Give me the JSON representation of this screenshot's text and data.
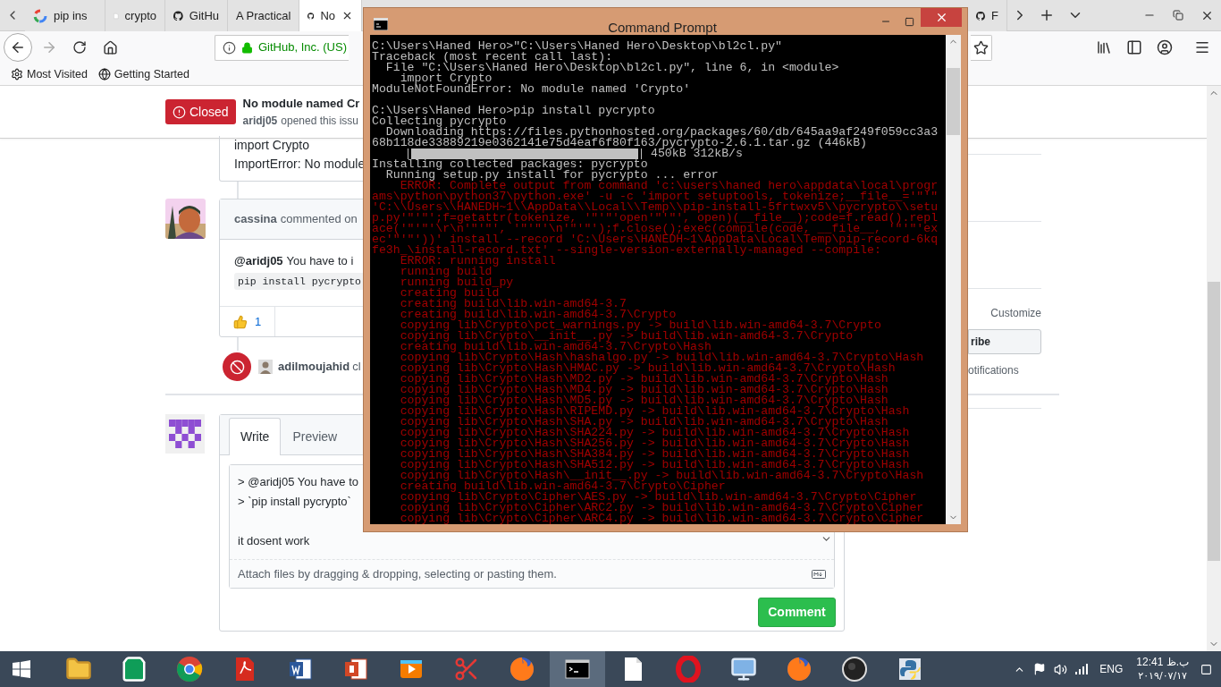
{
  "browser": {
    "tabs": [
      {
        "title": "pip ins",
        "kind": "google",
        "selected": false
      },
      {
        "title": "crypto",
        "kind": "page",
        "selected": false
      },
      {
        "title": "GitHu",
        "kind": "github",
        "selected": false
      },
      {
        "title": "A Practical",
        "kind": "none",
        "selected": false
      },
      {
        "title": "No",
        "kind": "github",
        "selected": true
      },
      {
        "title": "F",
        "kind": "github",
        "selected": false
      }
    ],
    "identity": "GitHub, Inc. (US)",
    "bookmarks": [
      {
        "label": "Most Visited",
        "kind": "gear"
      },
      {
        "label": "Getting Started",
        "kind": "globe"
      }
    ]
  },
  "issue": {
    "status": "Closed",
    "title": "No module named Cr",
    "author": "aridj05",
    "byline": "opened this issu",
    "body_lines": [
      "import Crypto",
      "ImportError: No module"
    ],
    "comment": {
      "author": "cassina",
      "action": "commented on",
      "mention": "@aridj05",
      "text": "You have to i",
      "code": "pip install pycrypto",
      "reaction_count": "1"
    },
    "event": {
      "actor": "adilmoujahid",
      "text": "cl"
    },
    "new_comment": {
      "tabs": [
        {
          "label": "Write",
          "selected": true
        },
        {
          "label": "Preview",
          "selected": false
        }
      ],
      "value": "> @aridj05 You have to\n> `pip install pycrypto`\n\nit dosent work",
      "attach": "Attach files by dragging & dropping, selecting or pasting them.",
      "button": "Comment"
    },
    "sidebar": {
      "customize": "Customize",
      "button": "ribe",
      "note": "otifications"
    }
  },
  "console": {
    "title": "Command Prompt",
    "lines": [
      {
        "kind": "normal",
        "text": "C:\\Users\\Haned Hero>\"C:\\Users\\Haned Hero\\Desktop\\bl2cl.py\""
      },
      {
        "kind": "normal",
        "text": "Traceback (most recent call last):"
      },
      {
        "kind": "normal",
        "text": "  File \"C:\\Users\\Haned Hero\\Desktop\\bl2cl.py\", line 6, in <module>"
      },
      {
        "kind": "normal",
        "text": "    import Crypto"
      },
      {
        "kind": "normal",
        "text": "ModuleNotFoundError: No module named 'Crypto'"
      },
      {
        "kind": "blank"
      },
      {
        "kind": "normal",
        "text": "C:\\Users\\Haned Hero>pip install pycrypto"
      },
      {
        "kind": "normal",
        "text": "Collecting pycrypto"
      },
      {
        "kind": "normal",
        "text": "  Downloading https://files.pythonhosted.org/packages/60/db/645aa9af249f059cc3a3"
      },
      {
        "kind": "normal",
        "text": "68b118de33889219e0362141e75d4eaf6f80f163/pycrypto-2.6.1.tar.gz (446kB)"
      },
      {
        "kind": "progress",
        "level": 1,
        "reading": "450kB 312kB/s"
      },
      {
        "kind": "normal",
        "text": "Installing collected packages: pycrypto"
      },
      {
        "kind": "normal",
        "text": "  Running setup.py install for pycrypto ... error"
      },
      {
        "kind": "error",
        "text": "    ERROR: Complete output from command 'c:\\users\\haned hero\\appdata\\local\\progr"
      },
      {
        "kind": "error",
        "text": "ams\\python\\python37\\python.exe' -u -c 'import setuptools, tokenize;__file__='\"'\""
      },
      {
        "kind": "error",
        "text": "'C:\\\\Users\\\\HANEDH~1\\\\AppData\\\\Local\\\\Temp\\\\pip-install-5frtwxv5\\\\pycrypto\\\\setu"
      },
      {
        "kind": "error",
        "text": "p.py'\"'\"';f=getattr(tokenize, '\"'\"'open'\"'\"', open)(__file__);code=f.read().repl"
      },
      {
        "kind": "error",
        "text": "ace('\"'\"'\\r\\n'\"'\"', '\"'\"'\\n'\"'\"');f.close();exec(compile(code, __file__, '\"'\"'ex"
      },
      {
        "kind": "error",
        "text": "ec'\"'\"'))' install --record 'C:\\Users\\HANEDH~1\\AppData\\Local\\Temp\\pip-record-6kq"
      },
      {
        "kind": "error",
        "text": "fe3h_\\install-record.txt' --single-version-externally-managed --compile:"
      },
      {
        "kind": "error",
        "text": "    ERROR: running install"
      },
      {
        "kind": "error",
        "text": "    running build"
      },
      {
        "kind": "error",
        "text": "    running build_py"
      },
      {
        "kind": "error",
        "text": "    creating build"
      },
      {
        "kind": "error",
        "text": "    creating build\\lib.win-amd64-3.7"
      },
      {
        "kind": "error",
        "text": "    creating build\\lib.win-amd64-3.7\\Crypto"
      },
      {
        "kind": "error",
        "text": "    copying lib\\Crypto\\pct_warnings.py -> build\\lib.win-amd64-3.7\\Crypto"
      },
      {
        "kind": "error",
        "text": "    copying lib\\Crypto\\__init__.py -> build\\lib.win-amd64-3.7\\Crypto"
      },
      {
        "kind": "error",
        "text": "    creating build\\lib.win-amd64-3.7\\Crypto\\Hash"
      },
      {
        "kind": "error",
        "text": "    copying lib\\Crypto\\Hash\\hashalgo.py -> build\\lib.win-amd64-3.7\\Crypto\\Hash"
      },
      {
        "kind": "error",
        "text": "    copying lib\\Crypto\\Hash\\HMAC.py -> build\\lib.win-amd64-3.7\\Crypto\\Hash"
      },
      {
        "kind": "error",
        "text": "    copying lib\\Crypto\\Hash\\MD2.py -> build\\lib.win-amd64-3.7\\Crypto\\Hash"
      },
      {
        "kind": "error",
        "text": "    copying lib\\Crypto\\Hash\\MD4.py -> build\\lib.win-amd64-3.7\\Crypto\\Hash"
      },
      {
        "kind": "error",
        "text": "    copying lib\\Crypto\\Hash\\MD5.py -> build\\lib.win-amd64-3.7\\Crypto\\Hash"
      },
      {
        "kind": "error",
        "text": "    copying lib\\Crypto\\Hash\\RIPEMD.py -> build\\lib.win-amd64-3.7\\Crypto\\Hash"
      },
      {
        "kind": "error",
        "text": "    copying lib\\Crypto\\Hash\\SHA.py -> build\\lib.win-amd64-3.7\\Crypto\\Hash"
      },
      {
        "kind": "error",
        "text": "    copying lib\\Crypto\\Hash\\SHA224.py -> build\\lib.win-amd64-3.7\\Crypto\\Hash"
      },
      {
        "kind": "error",
        "text": "    copying lib\\Crypto\\Hash\\SHA256.py -> build\\lib.win-amd64-3.7\\Crypto\\Hash"
      },
      {
        "kind": "error",
        "text": "    copying lib\\Crypto\\Hash\\SHA384.py -> build\\lib.win-amd64-3.7\\Crypto\\Hash"
      },
      {
        "kind": "error",
        "text": "    copying lib\\Crypto\\Hash\\SHA512.py -> build\\lib.win-amd64-3.7\\Crypto\\Hash"
      },
      {
        "kind": "error",
        "text": "    copying lib\\Crypto\\Hash\\__init__.py -> build\\lib.win-amd64-3.7\\Crypto\\Hash"
      },
      {
        "kind": "error",
        "text": "    creating build\\lib.win-amd64-3.7\\Crypto\\Cipher"
      },
      {
        "kind": "error",
        "text": "    copying lib\\Crypto\\Cipher\\AES.py -> build\\lib.win-amd64-3.7\\Crypto\\Cipher"
      },
      {
        "kind": "error",
        "text": "    copying lib\\Crypto\\Cipher\\ARC2.py -> build\\lib.win-amd64-3.7\\Crypto\\Cipher"
      },
      {
        "kind": "error",
        "text": "    copying lib\\Crypto\\Cipher\\ARC4.py -> build\\lib.win-amd64-3.7\\Crypto\\Cipher"
      }
    ]
  },
  "taskbar": {
    "apps": [
      {
        "kind": "folder",
        "selected": false
      },
      {
        "kind": "bag",
        "selected": false
      },
      {
        "kind": "chrome",
        "selected": false
      },
      {
        "kind": "pdf",
        "selected": false
      },
      {
        "kind": "word",
        "selected": false
      },
      {
        "kind": "slides",
        "selected": false
      },
      {
        "kind": "play",
        "selected": false
      },
      {
        "kind": "scissors",
        "selected": false
      },
      {
        "kind": "firefox",
        "selected": false
      },
      {
        "kind": "terminal",
        "selected": true
      },
      {
        "kind": "page",
        "selected": false
      },
      {
        "kind": "opera",
        "selected": false
      },
      {
        "kind": "monitor",
        "selected": false
      },
      {
        "kind": "firefox",
        "selected": false
      },
      {
        "kind": "circle",
        "selected": false
      },
      {
        "kind": "python",
        "selected": false
      }
    ],
    "language": "ENG",
    "time": "12:41 ب.ظ",
    "date": "۲۰۱۹/۰۷/۱۷"
  }
}
